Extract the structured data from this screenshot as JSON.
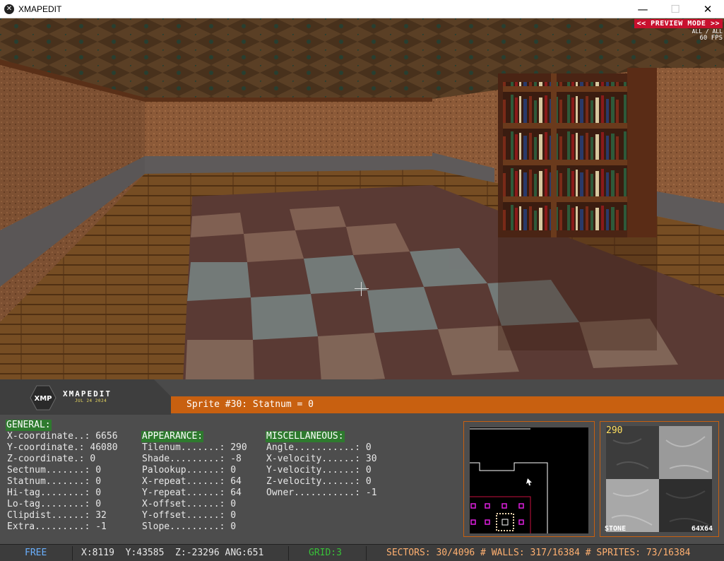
{
  "window": {
    "title": "XMAPEDIT",
    "icon": "xmapedit-app-icon",
    "controls": {
      "minimize": "—",
      "maximize": "☐",
      "close": "✕"
    }
  },
  "viewport": {
    "mode_badge": "<< PREVIEW MODE >>",
    "visibility": "ALL / ALL",
    "fps": "60 FPS"
  },
  "logo": {
    "mark": "XMP",
    "name": "XMAPEDIT",
    "date": "JUL 24 2024"
  },
  "status_message": "Sprite #30: Statnum = 0",
  "general": {
    "title": "GENERAL:",
    "rows": [
      "X-coordinate..: 6656",
      "Y-coordinate.: 46080",
      "Z-coordinate.: 0",
      "Sectnum.......: 0",
      "Statnum.......: 0",
      "Hi-tag........: 0",
      "Lo-tag........: 0",
      "Clipdist......: 32",
      "Extra.........: -1"
    ]
  },
  "appearance": {
    "title": "APPEARANCE:",
    "rows": [
      "Tilenum.......: 290",
      "Shade.........: -8",
      "Palookup......: 0",
      "X-repeat......: 64",
      "Y-repeat......: 64",
      "X-offset......: 0",
      "Y-offset......: 0",
      "Slope.........: 0"
    ]
  },
  "miscellaneous": {
    "title": "MISCELLANEOUS:",
    "rows": [
      "Angle...........: 0",
      "X-velocity......: 30",
      "Y-velocity......: 0",
      "Z-velocity......: 0",
      "Owner...........: -1"
    ]
  },
  "tile_preview": {
    "number": "290",
    "name": "STONE",
    "size": "64X64"
  },
  "statusbar": {
    "mode": "FREE",
    "coords": "X:8119  Y:43585  Z:-23296 ANG:651",
    "grid": "GRID:3",
    "counts": "SECTORS: 30/4096 # WALLS: 317/16384 # SPRITES: 73/16384"
  },
  "colors": {
    "accent_orange": "#c86010",
    "badge_red": "#c8102e",
    "section_green": "#2e7a2e",
    "grid_green": "#38c038",
    "free_blue": "#6ab0ff",
    "counts_orange": "#ffb070"
  }
}
